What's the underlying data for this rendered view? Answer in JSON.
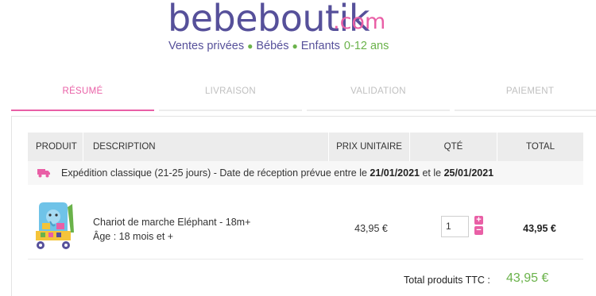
{
  "header": {
    "logo_main": "bebeboutik",
    "logo_tld": ".com",
    "tagline": {
      "item1": "Ventes privées",
      "item2": "Bébés",
      "item3": "Enfants",
      "age": "0-12 ans"
    }
  },
  "steps": [
    {
      "label": "RÉSUMÉ",
      "active": true
    },
    {
      "label": "LIVRAISON",
      "active": false
    },
    {
      "label": "VALIDATION",
      "active": false
    },
    {
      "label": "PAIEMENT",
      "active": false
    }
  ],
  "table": {
    "headers": {
      "produit": "PRODUIT",
      "description": "DESCRIPTION",
      "prix": "PRIX UNITAIRE",
      "qte": "QTÉ",
      "total": "TOTAL"
    }
  },
  "shipping": {
    "icon": "truck-icon",
    "text_before": "Expédition classique (21-25 jours) - Date de réception prévue entre le ",
    "date_from": "21/01/2021",
    "text_mid": " et le ",
    "date_to": "25/01/2021"
  },
  "item": {
    "name": "Chariot de marche Eléphant - 18m+",
    "age": "Âge : 18 mois et +",
    "unit_price": "43,95 €",
    "quantity": "1",
    "plus_label": "+",
    "minus_label": "−",
    "line_total": "43,95 €"
  },
  "summary": {
    "label": "Total produits TTC :",
    "value": "43,95 €"
  },
  "colors": {
    "brand_purple": "#56509a",
    "brand_pink": "#e95fa6",
    "brand_green": "#6ab24a"
  }
}
